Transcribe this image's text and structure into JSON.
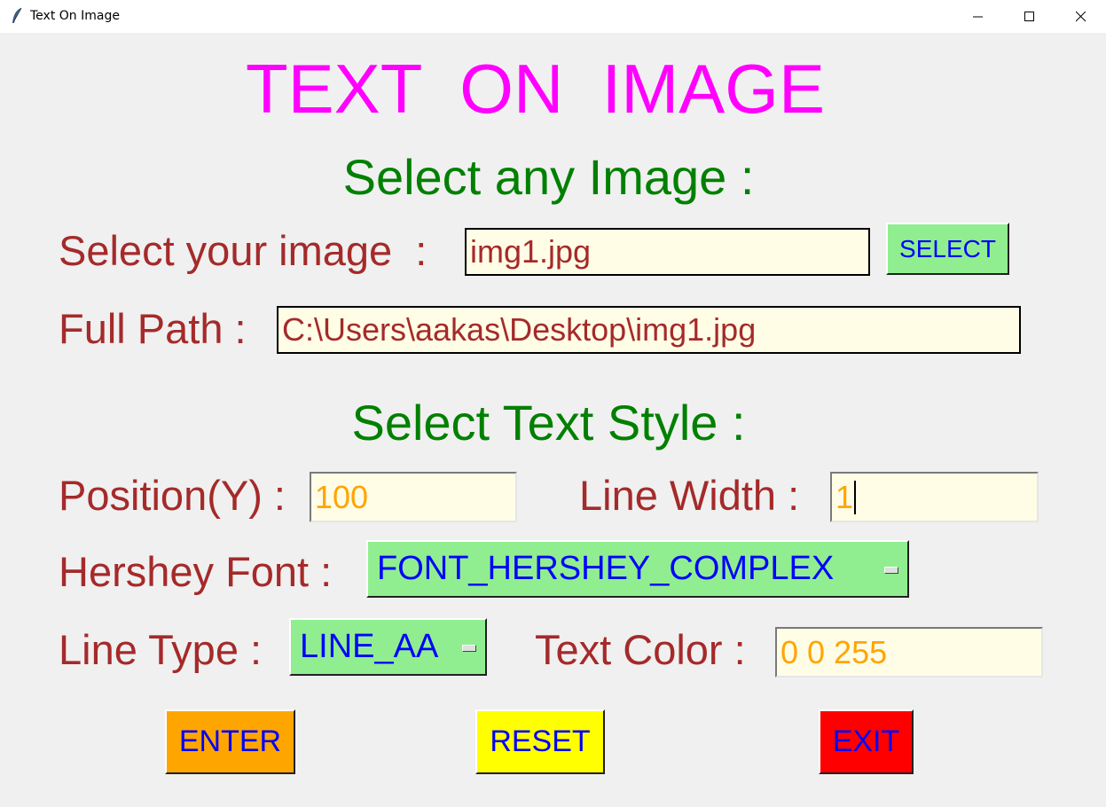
{
  "window": {
    "title": "Text On Image"
  },
  "heading": "TEXT  ON  IMAGE",
  "section_image": "Select any Image :",
  "image_label": "Select your image  :",
  "image_value": "img1.jpg",
  "select_button": "SELECT",
  "path_label": "Full Path :",
  "path_value": "C:\\Users\\aakas\\Desktop\\img1.jpg",
  "section_style": "Select Text Style :",
  "position_label": "Position(Y) :",
  "position_value": "100",
  "linewidth_label": "Line Width :",
  "linewidth_value": "1",
  "font_label": "Hershey Font :",
  "font_value": "FONT_HERSHEY_COMPLEX",
  "linetype_label": "Line Type :",
  "linetype_value": "LINE_AA",
  "color_label": "Text Color :",
  "color_value": "0 0 255",
  "buttons": {
    "enter": "ENTER",
    "reset": "RESET",
    "exit": "EXIT"
  },
  "colors": {
    "heading": "#ff00ff",
    "section": "#008000",
    "label": "#a52a2a",
    "entry_bg": "#fffde6",
    "enter_bg": "#ffa500",
    "reset_bg": "#ffff00",
    "exit_bg": "#ff0000",
    "select_bg": "#90ee90"
  }
}
